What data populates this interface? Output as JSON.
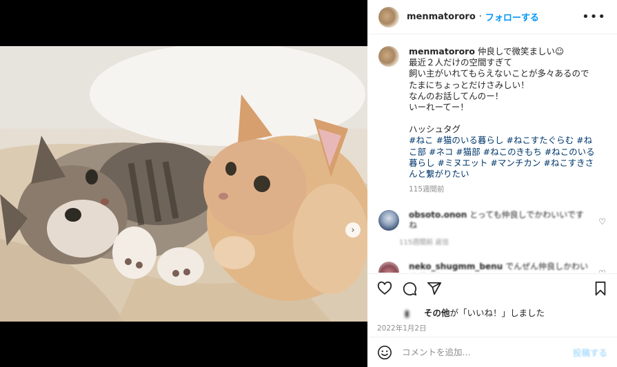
{
  "post": {
    "username": "menmatororo",
    "separator": "·",
    "follow_label": "フォローする",
    "more_icon": "more-horizontal-icon",
    "more_label": "•••"
  },
  "caption": {
    "username": "menmatororo",
    "lines": [
      "仲良しで微笑ましい☺",
      "最近２人だけの空間すぎて",
      "飼い主がいれてもらえないことが多々あるので",
      "たまにちょっとだけさみしい！",
      "なんのお話してんのー！",
      "いーれーてー！"
    ],
    "hashtag_heading": "ハッシュタグ",
    "hashtags": "#ねこ #猫のいる暮らし #ねこすたぐらむ #ねこ部 #ネコ #猫部 #ねこのきもち #ねこのいる暮らし #ミヌエット #マンチカン #ねこすきさんと繋がりたい",
    "time_ago": "115週間前"
  },
  "comments": [
    {
      "username": "obsoto.onon",
      "text": "とっても仲良しでかわいいですね",
      "meta": "115週間前 返信"
    },
    {
      "username": "neko_shugmm_benu",
      "text": "でんぜん仲良しかわいすぎます",
      "meta": ""
    }
  ],
  "actions": {
    "like_icon": "heart-icon",
    "comment_icon": "comment-icon",
    "share_icon": "share-icon",
    "save_icon": "bookmark-icon",
    "likes_others": "その他",
    "likes_suffix": "が「いいね！」しました",
    "date": "2022年1月2日"
  },
  "add_comment": {
    "placeholder": "コメントを追加...",
    "post_label": "投稿する",
    "emoji_icon": "emoji-icon"
  },
  "carousel": {
    "next_icon": "chevron-right-icon",
    "next_label": "›",
    "slide_count": 3,
    "current_slide": 1
  },
  "colors": {
    "accent": "#0095f6",
    "hashtag": "#00376b",
    "muted": "#8e8e8e"
  }
}
